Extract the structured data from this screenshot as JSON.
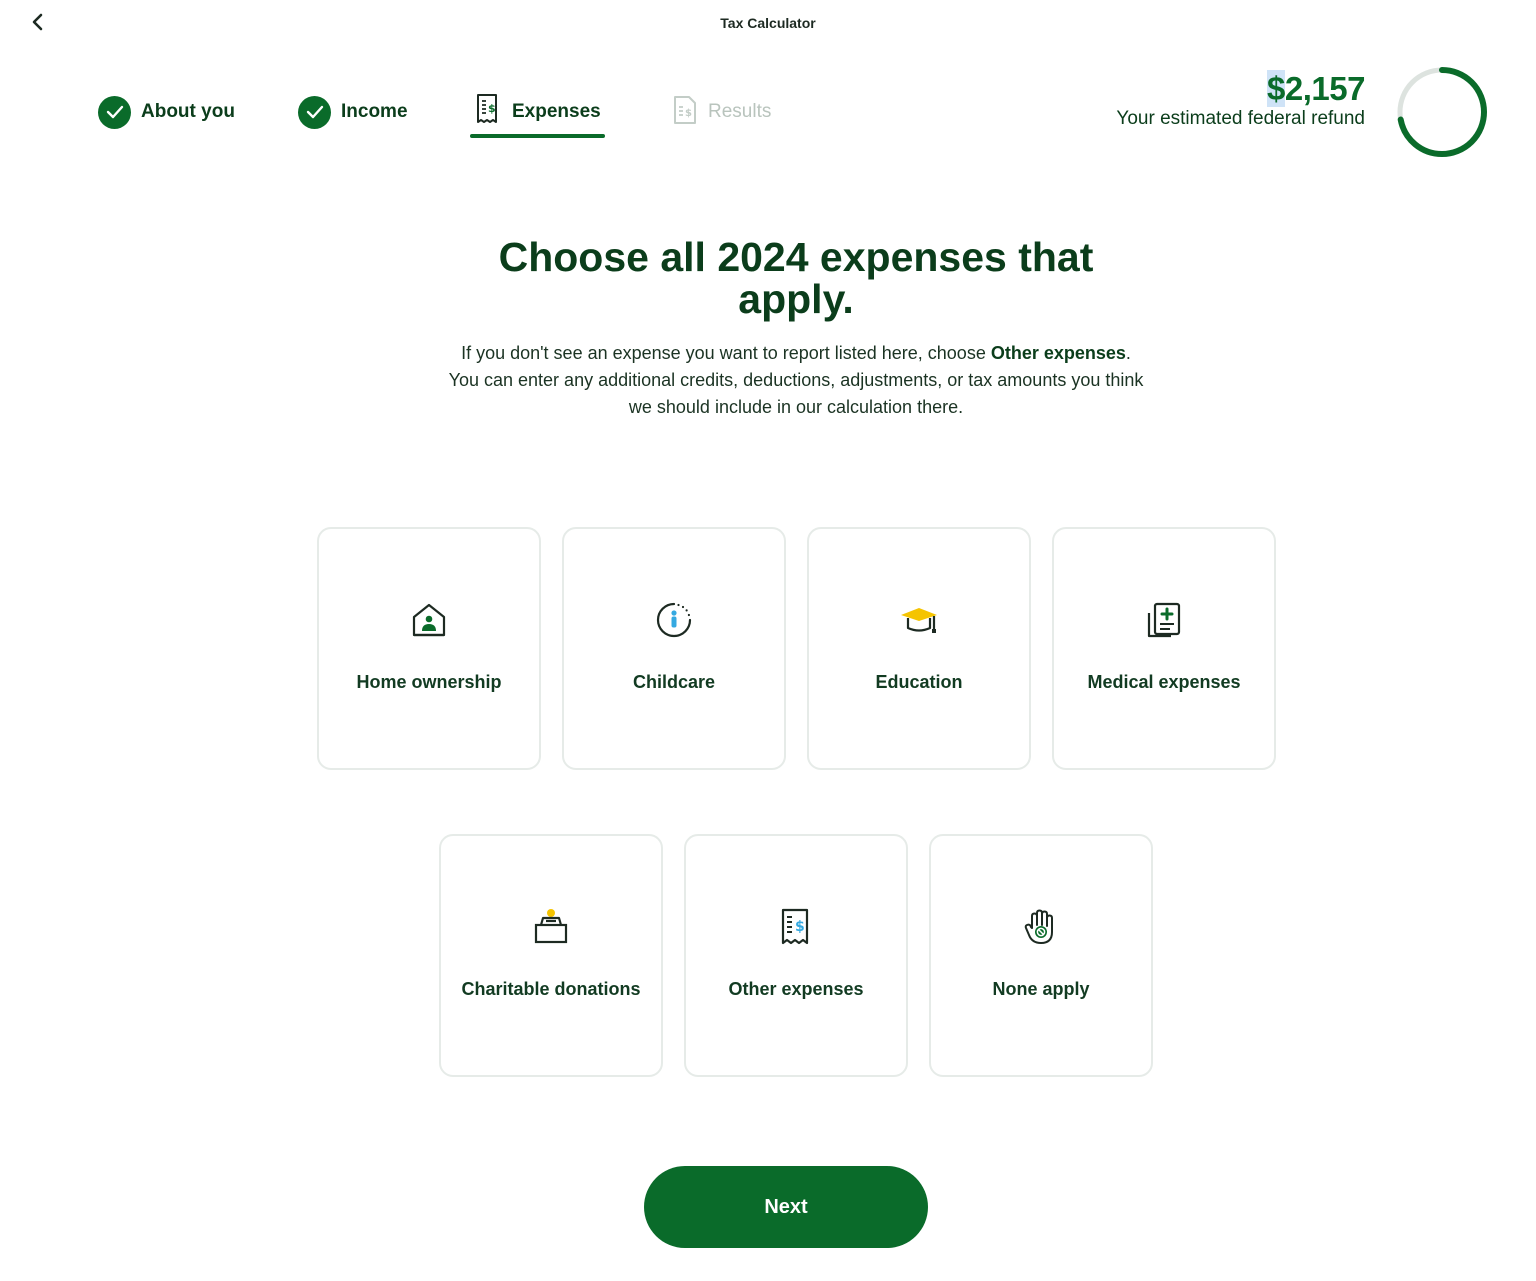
{
  "header": {
    "title": "Tax Calculator",
    "back_icon": "chevron-left-icon"
  },
  "stepper": {
    "steps": [
      {
        "label": "About you",
        "state": "completed"
      },
      {
        "label": "Income",
        "state": "completed"
      },
      {
        "label": "Expenses",
        "state": "current"
      },
      {
        "label": "Results",
        "state": "upcoming"
      }
    ]
  },
  "refund": {
    "currency": "$",
    "amount": "2,157",
    "caption": "Your estimated federal refund",
    "ring_fraction": 0.72
  },
  "main": {
    "heading_line1": "Choose all 2024 expenses that",
    "heading_line2": "apply.",
    "intro_part1": "If you don't see an expense you want to report listed here, choose ",
    "intro_bold": "Other expenses",
    "intro_part2": ". You can enter any additional credits, deductions, adjustments, or tax amounts you think we should include in our calculation there."
  },
  "options": [
    {
      "label": "Home ownership",
      "icon": "house-icon"
    },
    {
      "label": "Childcare",
      "icon": "child-icon"
    },
    {
      "label": "Education",
      "icon": "graduation-cap-icon"
    },
    {
      "label": "Medical expenses",
      "icon": "medical-document-icon"
    },
    {
      "label": "Charitable donations",
      "icon": "donation-box-icon"
    },
    {
      "label": "Other expenses",
      "icon": "receipt-icon"
    },
    {
      "label": "None apply",
      "icon": "stop-hand-icon"
    }
  ],
  "actions": {
    "next_label": "Next"
  },
  "colors": {
    "brand_green": "#0a6b2a",
    "text_dark": "#0b3d1b",
    "disabled_text": "#b9c4bd",
    "tile_border": "#e6ebe8",
    "ring_track": "#dde3df",
    "accent_yellow": "#f5c400",
    "accent_blue": "#35a9e1"
  }
}
